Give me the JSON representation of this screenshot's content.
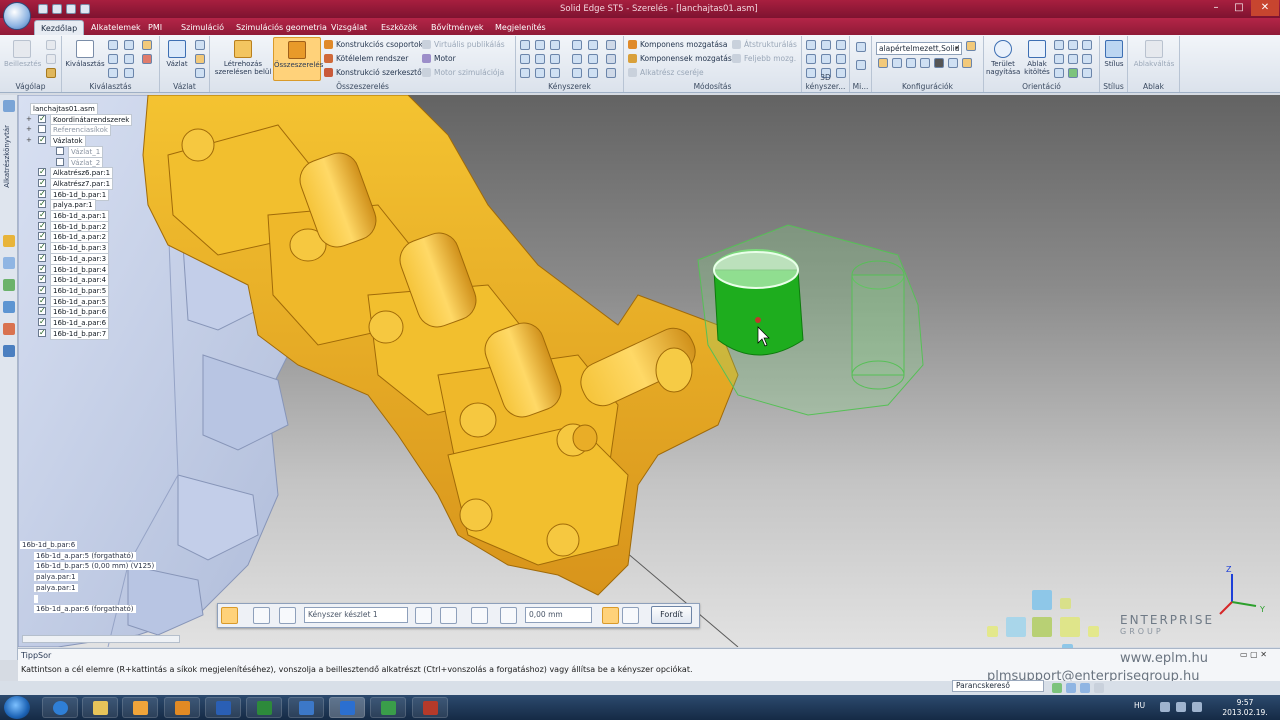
{
  "window": {
    "title": "Solid Edge ST5 - Szerelés - [lanchajtas01.asm]",
    "min": "–",
    "max": "□",
    "close": "✕"
  },
  "tabs": [
    "Kezdőlap",
    "Alkatelemek",
    "PMI",
    "Szimuláció",
    "Szimulációs geometria",
    "Vizsgálat",
    "Eszközök",
    "Bővítmények",
    "Megjelenítés"
  ],
  "ribbon": {
    "vagolap": {
      "label": "Vágólap",
      "beillesztes": "Beillesztés"
    },
    "kivalasztas": {
      "label": "Kiválasztás",
      "btn": "Kiválasztás"
    },
    "vazlat": {
      "label": "Vázlat",
      "btn": "Vázlat"
    },
    "osszeszereles": {
      "label": "Összeszerelés",
      "letrehozas": "Létrehozás szerelésen belül",
      "osszeszereles_btn": "Összeszerelés",
      "konstrukcios_csoportok": "Konstrukciós csoportok",
      "koteleem_rendszer": "Kötélelem rendszer",
      "konstrukcio_szerkeszto": "Konstrukció szerkesztő",
      "virtualis_publikalas": "Virtuális publikálás",
      "motor": "Motor",
      "motor_szimulacio": "Motor szimulációja"
    },
    "kenyszerek": {
      "label": "Kényszerek"
    },
    "modositas": {
      "label": "Módosítás",
      "komponens_mozgatasa": "Komponens mozgatása",
      "komponensek_mozgatasa": "Komponensek mozgatása",
      "alkatresz_csereje": "Alkatrész cseréje",
      "atstrukturalas": "Átstrukturálás",
      "feljebb_mozg": "Feljebb mozg."
    },
    "kenyszerek3d": {
      "label": "3D kényszer..."
    },
    "mi": {
      "label": "Mi..."
    },
    "konfiguraciok": {
      "label": "Konfigurációk",
      "combo": "alapértelmezett,Solid"
    },
    "orientacio": {
      "label": "Orientáció",
      "terulet": "Terület nagyítása",
      "ablak": "Ablak kitöltés"
    },
    "stilus": {
      "label": "Stílus",
      "btn": "Stílus"
    },
    "ablakok": {
      "label": "Ablak",
      "btn": "Ablakváltás"
    }
  },
  "leftbar": {
    "label": "Alkatrészkönyvtár"
  },
  "tree": {
    "root": "lanchajtas01.asm",
    "items": [
      {
        "label": "Koordinátarendszerek",
        "checked": true,
        "dim": false
      },
      {
        "label": "Referenciasíkok",
        "checked": false,
        "dim": true
      },
      {
        "label": "Vázlatok",
        "checked": true,
        "dim": false
      },
      {
        "label": "Vázlat_1",
        "checked": false,
        "dim": true
      },
      {
        "label": "Vázlat_2",
        "checked": false,
        "dim": true
      },
      {
        "label": "Alkatrész6.par:1",
        "checked": true,
        "dim": false
      },
      {
        "label": "Alkatrész7.par:1",
        "checked": true,
        "dim": false
      },
      {
        "label": "16b-1d_b.par:1",
        "checked": true,
        "dim": false
      },
      {
        "label": "palya.par:1",
        "checked": true,
        "dim": false
      },
      {
        "label": "16b-1d_a.par:1",
        "checked": true,
        "dim": false
      },
      {
        "label": "16b-1d_b.par:2",
        "checked": true,
        "dim": false
      },
      {
        "label": "16b-1d_a.par:2",
        "checked": true,
        "dim": false
      },
      {
        "label": "16b-1d_b.par:3",
        "checked": true,
        "dim": false
      },
      {
        "label": "16b-1d_a.par:3",
        "checked": true,
        "dim": false
      },
      {
        "label": "16b-1d_b.par:4",
        "checked": true,
        "dim": false
      },
      {
        "label": "16b-1d_a.par:4",
        "checked": true,
        "dim": false
      },
      {
        "label": "16b-1d_b.par:5",
        "checked": true,
        "dim": false
      },
      {
        "label": "16b-1d_a.par:5",
        "checked": true,
        "dim": false
      },
      {
        "label": "16b-1d_b.par:6",
        "checked": true,
        "dim": false
      },
      {
        "label": "16b-1d_a.par:6",
        "checked": true,
        "dim": false
      },
      {
        "label": "16b-1d_b.par:7",
        "checked": true,
        "dim": false
      }
    ]
  },
  "relations": {
    "header": "16b-1d_b.par:6",
    "items": [
      "16b-1d_a.par:5   (forgatható)",
      "16b-1d_b.par:5   (0,00 mm)   (V125)",
      "palya.par:1",
      "palya.par:1",
      "",
      "16b-1d_a.par:6   (forgatható)"
    ]
  },
  "commandbar": {
    "constraint": "Kényszer készlet 1",
    "offset": "0,00 mm",
    "flip": "Fordít"
  },
  "tip": {
    "label": "TippSor",
    "text": "Kattintson a cél elemre (R+kattintás a síkok megjelenítéséhez), vonszolja a beillesztendő alkatrészt (Ctrl+vonszolás a forgatáshoz) vagy állítsa be a kényszer opciókat."
  },
  "command_search": "Parancskereső",
  "watermark": {
    "brand": "ENTERPRISE",
    "group": "GROUP",
    "url": "www.eplm.hu",
    "email": "plmsupport@enterprisegroup.hu"
  },
  "triad": {
    "z": "Z",
    "y": "Y"
  },
  "taskbar": {
    "lang": "HU",
    "time": "9:57",
    "date": "2013.02.19."
  },
  "colors": {
    "title_bar": "#8f1a37",
    "chain": "#e6a817",
    "selected": "#13a313",
    "sprocket": "#c9d3ea",
    "accent": "#ffd27a"
  }
}
